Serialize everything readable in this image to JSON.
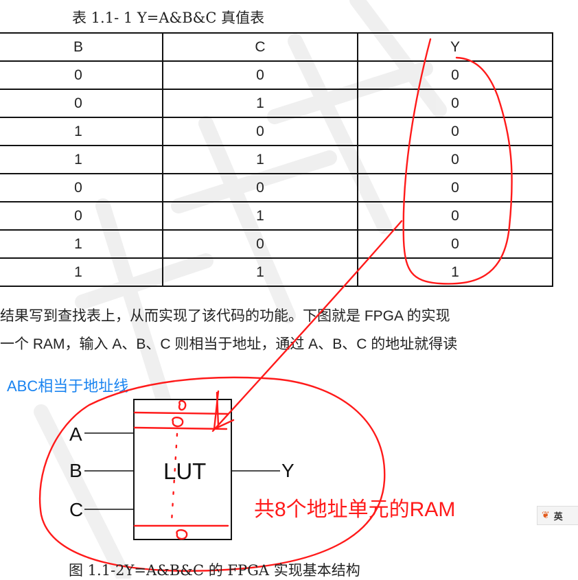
{
  "table_caption": "表 1.1- 1 Y=A&B&C 真值表",
  "table": {
    "headers": [
      "B",
      "C",
      "Y"
    ],
    "rows": [
      [
        "0",
        "0",
        "0"
      ],
      [
        "0",
        "1",
        "0"
      ],
      [
        "1",
        "0",
        "0"
      ],
      [
        "1",
        "1",
        "0"
      ],
      [
        "0",
        "0",
        "0"
      ],
      [
        "0",
        "1",
        "0"
      ],
      [
        "1",
        "0",
        "0"
      ],
      [
        "1",
        "1",
        "1"
      ]
    ]
  },
  "paragraph": {
    "line1": "结果写到查找表上，从而实现了该代码的功能。下图就是 FPGA 的实现",
    "line2": "一个 RAM，输入 A、B、C 则相当于地址，通过 A、B、C 的地址就得读"
  },
  "annotation_blue": "ABC相当于地址线",
  "diagram": {
    "box_label": "LUT",
    "inputs": [
      "A",
      "B",
      "C"
    ],
    "output": "Y"
  },
  "annotation_red": "共8个地址单元的RAM",
  "figure_caption": "图 1.1-2Y=A&B&C 的 FPGA 实现基本结构",
  "ime_indicator": {
    "icon": "paw-icon",
    "label": "英"
  },
  "colors": {
    "ink_red": "#ff1a1a",
    "note_blue": "#1a84f0",
    "watermark": "#d9d9d9"
  }
}
